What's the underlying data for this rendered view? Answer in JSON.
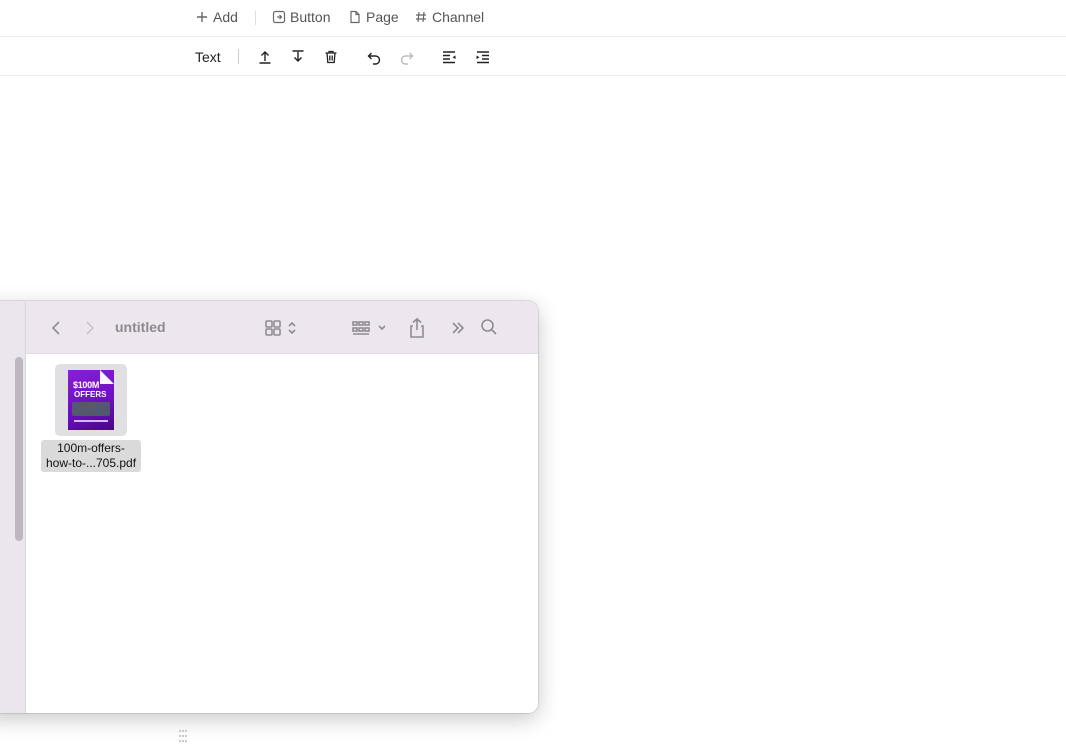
{
  "topbar": {
    "add_label": "Add",
    "button_label": "Button",
    "page_label": "Page",
    "channel_label": "Channel"
  },
  "toolbar": {
    "text_label": "Text",
    "buttons": [
      "upload-icon",
      "download-icon",
      "trash-icon",
      "undo-icon",
      "redo-icon",
      "outdent-icon",
      "indent-icon"
    ]
  },
  "finder": {
    "title": "untitled",
    "file": {
      "name_line1": "100m-offers-",
      "name_line2": "how-to-...705.pdf",
      "thumb_title": "$100M",
      "thumb_subtitle": "OFFERS"
    }
  },
  "colors": {
    "finder_sidebar": "#ebe5ee",
    "finder_titlebar": "#ede6ef",
    "book_cover": "#7a17cc"
  }
}
